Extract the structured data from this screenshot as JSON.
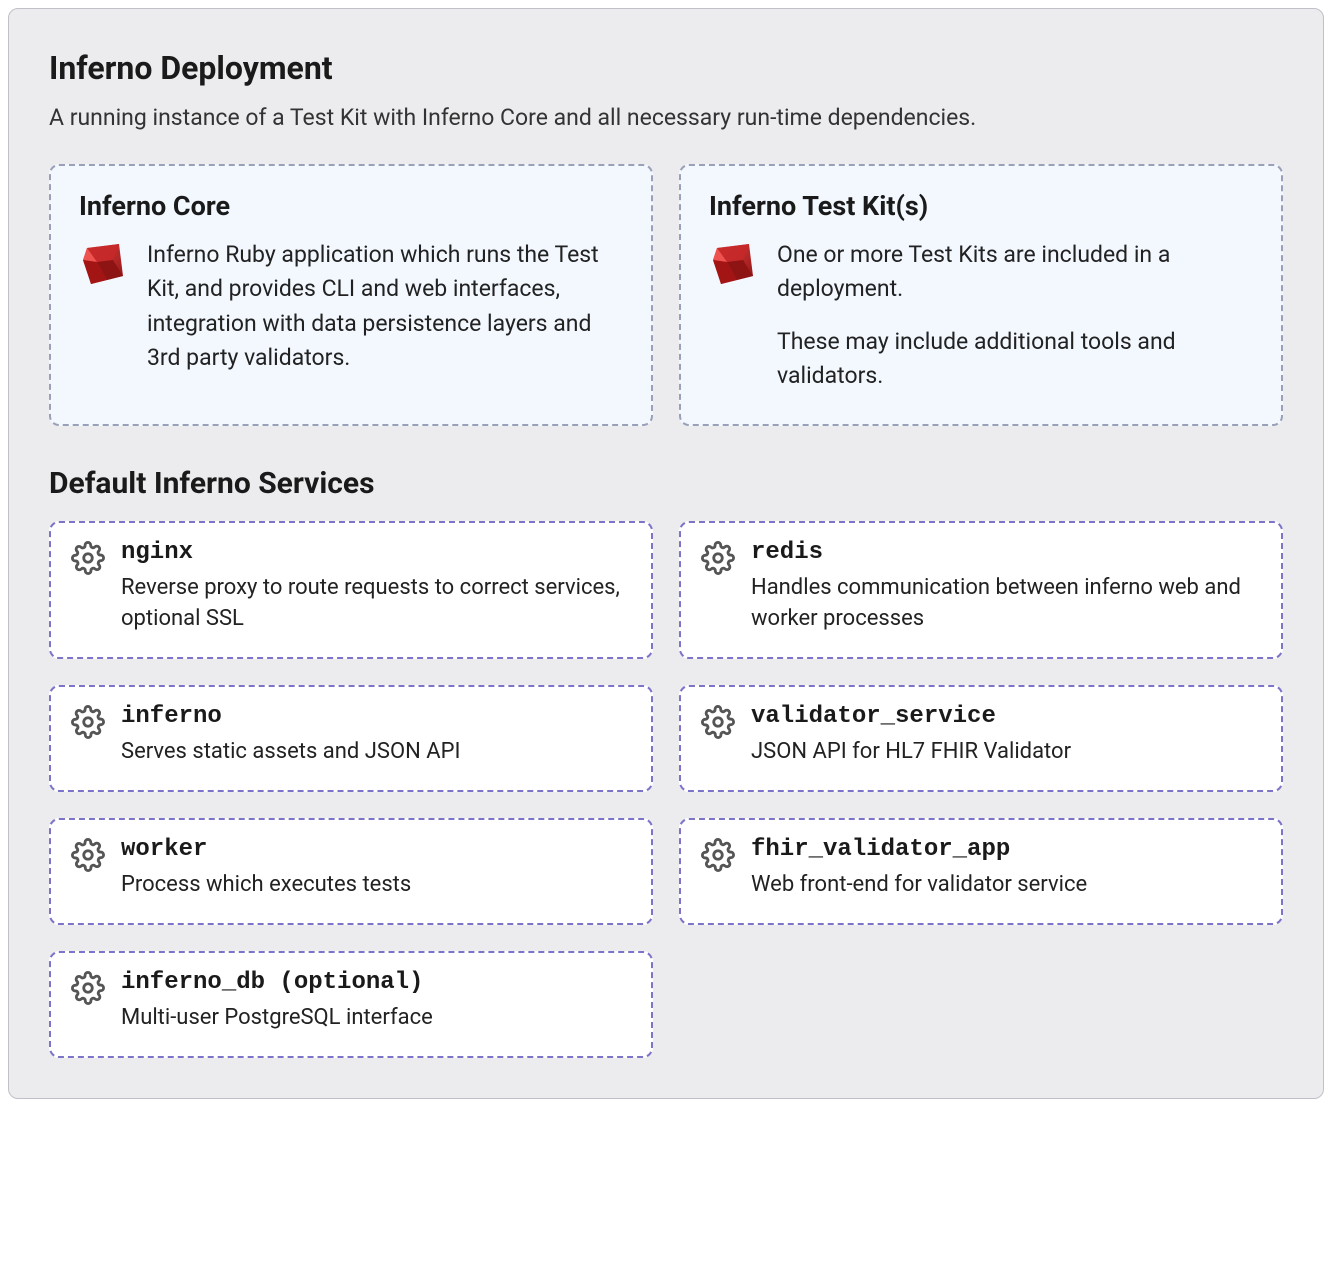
{
  "deployment": {
    "title": "Inferno Deployment",
    "subtitle": "A running instance of a Test Kit with Inferno Core and all necessary run-time dependencies."
  },
  "core_cards": [
    {
      "title": "Inferno Core",
      "paragraphs": [
        "Inferno Ruby application which runs the Test Kit, and provides CLI and web interfaces, integration with data persistence layers and 3rd party validators."
      ]
    },
    {
      "title": "Inferno Test Kit(s)",
      "paragraphs": [
        "One or more Test Kits are included in a deployment.",
        "These may include additional tools and validators."
      ]
    }
  ],
  "services_section_title": "Default Inferno Services",
  "services": [
    {
      "name": "nginx",
      "desc": "Reverse proxy to route requests to correct services, optional SSL"
    },
    {
      "name": "redis",
      "desc": "Handles communication between inferno web and worker processes"
    },
    {
      "name": "inferno",
      "desc": "Serves static assets and JSON API"
    },
    {
      "name": "validator_service",
      "desc": "JSON API for HL7 FHIR Validator"
    },
    {
      "name": "worker",
      "desc": "Process which executes tests"
    },
    {
      "name": "fhir_validator_app",
      "desc": "Web front-end for validator service"
    },
    {
      "name": "inferno_db (optional)",
      "desc": "Multi-user PostgreSQL interface"
    }
  ]
}
